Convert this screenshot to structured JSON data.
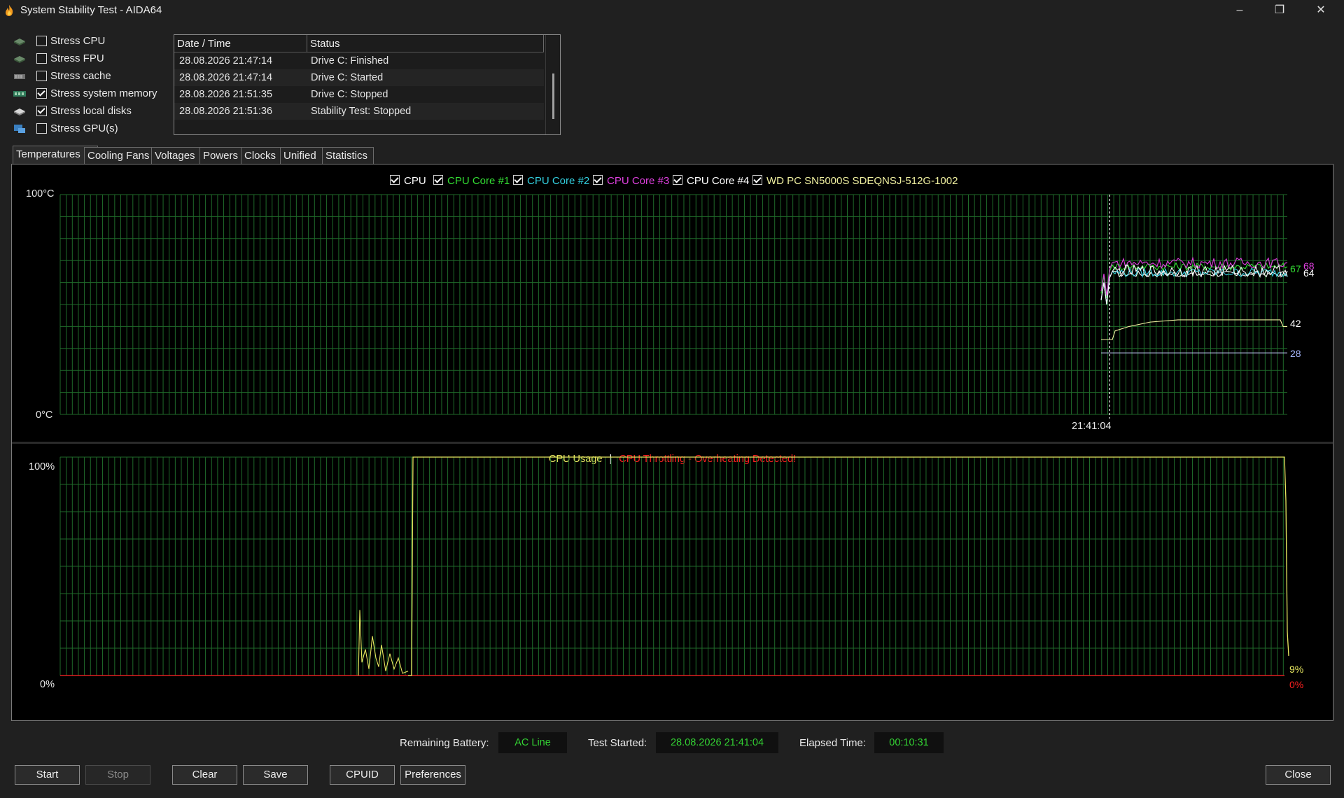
{
  "window": {
    "title": "System Stability Test - AIDA64",
    "minimize_glyph": "–",
    "restore_glyph": "❐",
    "close_glyph": "✕"
  },
  "stress_options": [
    {
      "label": "Stress CPU",
      "checked": false,
      "icon": "cpu-icon"
    },
    {
      "label": "Stress FPU",
      "checked": false,
      "icon": "fpu-icon"
    },
    {
      "label": "Stress cache",
      "checked": false,
      "icon": "cache-icon"
    },
    {
      "label": "Stress system memory",
      "checked": true,
      "icon": "memory-icon"
    },
    {
      "label": "Stress local disks",
      "checked": true,
      "icon": "disk-icon"
    },
    {
      "label": "Stress GPU(s)",
      "checked": false,
      "icon": "gpu-icon"
    }
  ],
  "status_table": {
    "headers": [
      "Date / Time",
      "Status"
    ],
    "rows": [
      {
        "datetime": "28.08.2026 21:47:14",
        "status": "Drive C: Finished"
      },
      {
        "datetime": "28.08.2026 21:47:14",
        "status": "Drive C: Started"
      },
      {
        "datetime": "28.08.2026 21:51:35",
        "status": "Drive C: Stopped"
      },
      {
        "datetime": "28.08.2026 21:51:36",
        "status": "Stability Test: Stopped"
      }
    ]
  },
  "tabs": [
    "Temperatures",
    "Cooling Fans",
    "Voltages",
    "Powers",
    "Clocks",
    "Unified",
    "Statistics"
  ],
  "active_tab": "Temperatures",
  "temperature_chart": {
    "legend": [
      {
        "name": "CPU",
        "color": "#ffffff"
      },
      {
        "name": "CPU Core #1",
        "color": "#33dd33"
      },
      {
        "name": "CPU Core #2",
        "color": "#33d0e0"
      },
      {
        "name": "CPU Core #3",
        "color": "#e040e0"
      },
      {
        "name": "CPU Core #4",
        "color": "#ffffff"
      },
      {
        "name": "WD PC SN5000S SDEQNSJ-512G-1002",
        "color": "#f0f0a0"
      }
    ],
    "y_max_label": "100°C",
    "y_min_label": "0°C",
    "time_label": "21:41:04",
    "end_values": [
      {
        "text": "68",
        "color": "#e040e0"
      },
      {
        "text": "67",
        "color": "#33dd33"
      },
      {
        "text": "64",
        "color": "#ffffff"
      },
      {
        "text": "42",
        "color": "#ffffff"
      },
      {
        "text": "28",
        "color": "#a8b8ff"
      }
    ]
  },
  "usage_chart": {
    "title_usage": "CPU Usage",
    "separator": "|",
    "title_throttle": "CPU Throttling - Overheating Detected!",
    "usage_color": "#e8e860",
    "throttle_color": "#ff2020",
    "y_max_label": "100%",
    "y_min_label": "0%",
    "end_usage_value": "9%",
    "end_throttle_value": "0%"
  },
  "info": {
    "battery_label": "Remaining Battery:",
    "battery_value": "AC Line",
    "started_label": "Test Started:",
    "started_value": "28.08.2026 21:41:04",
    "elapsed_label": "Elapsed Time:",
    "elapsed_value": "00:10:31"
  },
  "buttons": {
    "start": "Start",
    "stop": "Stop",
    "clear": "Clear",
    "save": "Save",
    "cpuid": "CPUID",
    "preferences": "Preferences",
    "close": "Close"
  },
  "chart_data": [
    {
      "type": "line",
      "y_unit": "°C",
      "ylim": [
        0,
        100
      ],
      "x_marker": "21:41:04",
      "series": [
        {
          "name": "CPU",
          "end_value": 64
        },
        {
          "name": "CPU Core #1",
          "end_value": 67
        },
        {
          "name": "CPU Core #2",
          "end_value": 64
        },
        {
          "name": "CPU Core #3",
          "end_value": 68
        },
        {
          "name": "CPU Core #4",
          "end_value": 64
        },
        {
          "name": "WD PC SN5000S SDEQNSJ-512G-1002",
          "end_value": 42
        },
        {
          "end_value": 28
        }
      ]
    },
    {
      "type": "line",
      "y_unit": "%",
      "ylim": [
        0,
        100
      ],
      "series": [
        {
          "name": "CPU Usage",
          "end_value": 9
        },
        {
          "name": "CPU Throttling",
          "end_value": 0
        }
      ]
    }
  ]
}
